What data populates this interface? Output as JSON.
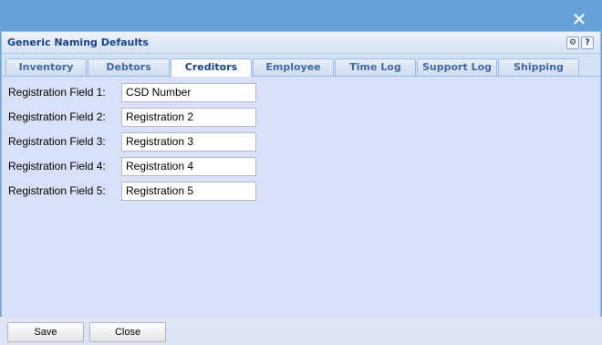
{
  "window": {
    "close_glyph": "✕"
  },
  "panel": {
    "title": "Generic Naming Defaults"
  },
  "tabs": [
    {
      "label": "Inventory",
      "active": false
    },
    {
      "label": "Debtors",
      "active": false
    },
    {
      "label": "Creditors",
      "active": true
    },
    {
      "label": "Employee",
      "active": false
    },
    {
      "label": "Time Log",
      "active": false
    },
    {
      "label": "Support Log",
      "active": false
    },
    {
      "label": "Shipping",
      "active": false
    }
  ],
  "fields": [
    {
      "label": "Registration Field 1:",
      "value": "CSD Number"
    },
    {
      "label": "Registration Field 2:",
      "value": "Registration 2"
    },
    {
      "label": "Registration Field 3:",
      "value": "Registration 3"
    },
    {
      "label": "Registration Field 4:",
      "value": "Registration 4"
    },
    {
      "label": "Registration Field 5:",
      "value": "Registration 5"
    }
  ],
  "buttons": {
    "save": "Save",
    "close": "Close"
  },
  "colors": {
    "titlebar": "#66a1dc",
    "panel": "#dce4f6",
    "header_text": "#15428b"
  }
}
